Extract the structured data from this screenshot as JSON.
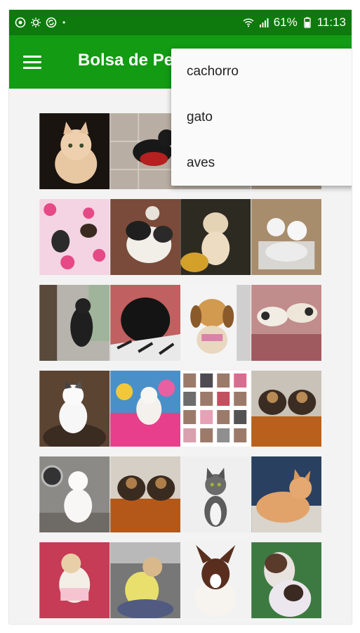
{
  "status_bar": {
    "battery": "61%",
    "time": "11:13"
  },
  "app_bar": {
    "title": "Bolsa de Pets",
    "menu_icon": "hamburger-menu-icon"
  },
  "dropdown": {
    "items": [
      "cachorro",
      "gato",
      "aves"
    ]
  },
  "gallery": {
    "rows": [
      [
        "kitten-orange-cream",
        "dog-black-on-tiles",
        "photo-partial",
        "photo-partial"
      ],
      [
        "cat-on-hearts-blanket",
        "puppy-black-white",
        "puppy-tan",
        "two-white-kittens"
      ],
      [
        "dog-black-window",
        "dog-black-closeup",
        "puppy-beagle",
        "dogs-on-blanket"
      ],
      [
        "cat-white",
        "dog-white-pink-toys",
        "collage-grid",
        "yorkie-puppies-box"
      ],
      [
        "dog-white-maltese",
        "yorkie-puppies-floor",
        "kitten-tabby",
        "cat-orange-lying"
      ],
      [
        "puppy-held-red",
        "puppy-dressed",
        "dog-brown-white",
        "dog-held-person"
      ]
    ]
  },
  "colors": {
    "status_bar": "#0e7a0d",
    "app_bar": "#139b13",
    "menu_bg": "#fafafa"
  }
}
